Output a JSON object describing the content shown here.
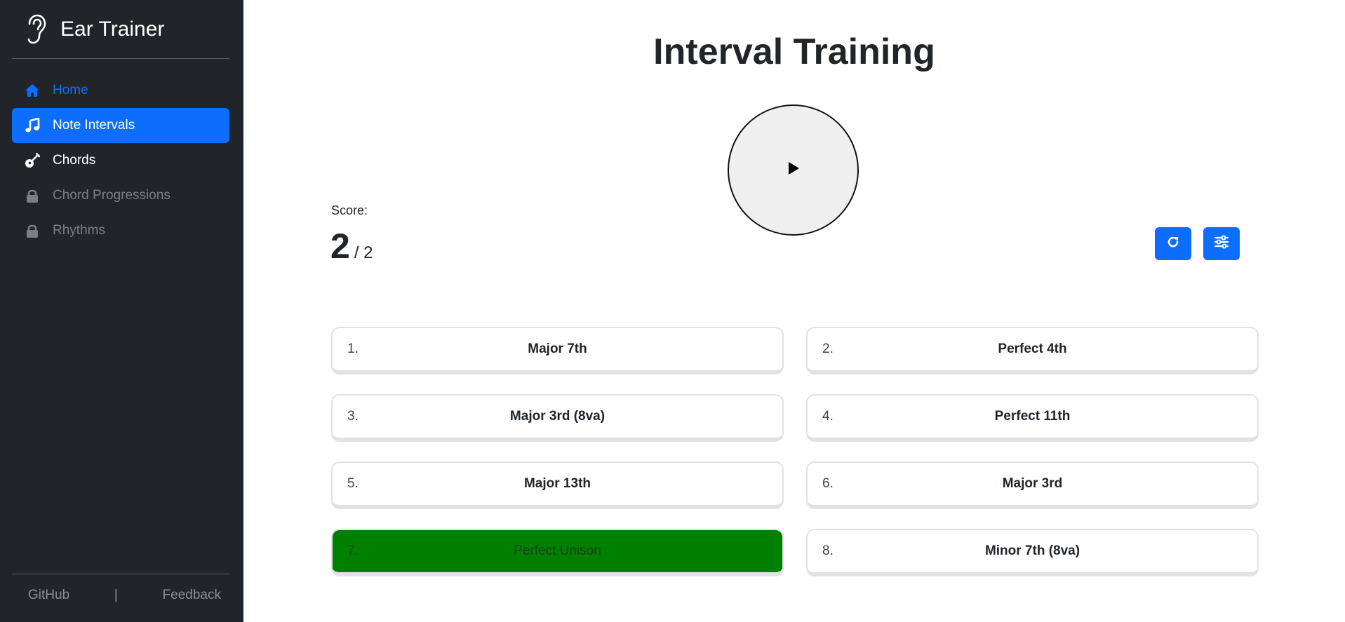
{
  "app": {
    "title": "Ear Trainer"
  },
  "sidebar": {
    "items": [
      {
        "label": "Home",
        "icon": "home-icon",
        "state": "link"
      },
      {
        "label": "Note Intervals",
        "icon": "music-note-icon",
        "state": "active"
      },
      {
        "label": "Chords",
        "icon": "guitar-icon",
        "state": "normal"
      },
      {
        "label": "Chord Progressions",
        "icon": "lock-icon",
        "state": "locked"
      },
      {
        "label": "Rhythms",
        "icon": "lock-icon",
        "state": "locked"
      }
    ],
    "footer": {
      "github": "GitHub",
      "separator": "|",
      "feedback": "Feedback"
    }
  },
  "main": {
    "title": "Interval Training",
    "play_icon": "play-icon",
    "score": {
      "label": "Score:",
      "value": "2",
      "total": "/ 2"
    },
    "tools": {
      "reset_icon": "redo-icon",
      "settings_icon": "sliders-icon"
    },
    "answers": [
      {
        "num": "1.",
        "label": "Major 7th"
      },
      {
        "num": "2.",
        "label": "Perfect 4th"
      },
      {
        "num": "3.",
        "label": "Major 3rd (8va)"
      },
      {
        "num": "4.",
        "label": "Perfect 11th"
      },
      {
        "num": "5.",
        "label": "Major 13th"
      },
      {
        "num": "6.",
        "label": "Major 3rd"
      },
      {
        "num": "7.",
        "label": "Perfect Unison",
        "state": "correct"
      },
      {
        "num": "8.",
        "label": "Minor 7th (8va)"
      }
    ]
  },
  "colors": {
    "sidebar_bg": "#212529",
    "accent": "#0d6efd",
    "correct": "#008000"
  }
}
